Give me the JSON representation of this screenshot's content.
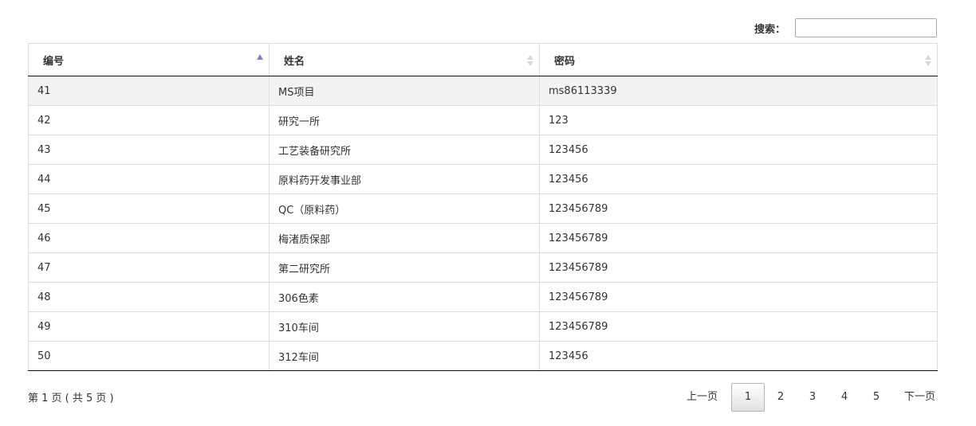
{
  "search": {
    "label": "搜索：",
    "value": "",
    "placeholder": ""
  },
  "table": {
    "columns": [
      {
        "label": "编号",
        "sort": "ascending"
      },
      {
        "label": "姓名",
        "sort": "none"
      },
      {
        "label": "密码",
        "sort": "none"
      }
    ],
    "rows": [
      {
        "id": "41",
        "name": "MS项目",
        "password": "ms86113339"
      },
      {
        "id": "42",
        "name": "研究一所",
        "password": "123"
      },
      {
        "id": "43",
        "name": "工艺装备研究所",
        "password": "123456"
      },
      {
        "id": "44",
        "name": "原料药开发事业部",
        "password": "123456"
      },
      {
        "id": "45",
        "name": "QC（原料药）",
        "password": "123456789"
      },
      {
        "id": "46",
        "name": "梅渚质保部",
        "password": "123456789"
      },
      {
        "id": "47",
        "name": "第二研究所",
        "password": "123456789"
      },
      {
        "id": "48",
        "name": "306色素",
        "password": "123456789"
      },
      {
        "id": "49",
        "name": "310车间",
        "password": "123456789"
      },
      {
        "id": "50",
        "name": "312车间",
        "password": "123456"
      }
    ]
  },
  "footer": {
    "info": "第 1 页 ( 共 5 页 )",
    "prev_label": "上一页",
    "next_label": "下一页",
    "pages": [
      "1",
      "2",
      "3",
      "4",
      "5"
    ],
    "current_page": "1"
  },
  "colors": {
    "sort_active": "#7b80c8",
    "sort_inactive": "#d8d8d8",
    "row_stripe": "#f3f3f3",
    "border": "#dddddd"
  }
}
